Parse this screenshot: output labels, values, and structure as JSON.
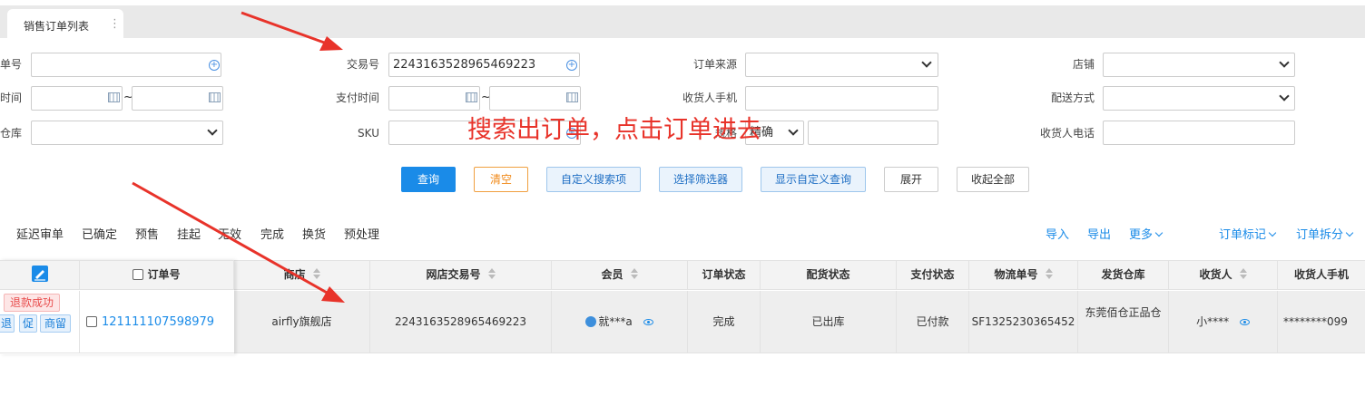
{
  "tab": {
    "title": "销售订单列表",
    "menu_glyph": "⋮"
  },
  "filters": {
    "row1": {
      "order_no_label": "单号",
      "trade_no_label": "交易号",
      "trade_no_value": "2243163528965469223",
      "source_label": "订单来源",
      "shop_label": "店铺"
    },
    "row2": {
      "time_label": "时间",
      "pay_time_label": "支付时间",
      "receiver_phone_label": "收货人手机",
      "delivery_label": "配送方式",
      "tilde": "~"
    },
    "row3": {
      "warehouse_label": "仓库",
      "sku_label": "SKU",
      "exact_label": "規格",
      "exact_value": "精确",
      "receiver_tel_label": "收货人电话"
    }
  },
  "annotation": {
    "text": "搜索出订单，点击订单进去",
    "color": "#e8332a"
  },
  "buttons": {
    "query": "查询",
    "clear": "清空",
    "custom_search": "自定义搜索项",
    "select_filter": "选择筛选器",
    "show_custom_query": "显示自定义查询",
    "expand": "展开",
    "collapse_all": "收起全部"
  },
  "status_tabs": [
    "延迟审单",
    "已确定",
    "预售",
    "挂起",
    "无效",
    "完成",
    "换货",
    "预处理"
  ],
  "toolbar_links": {
    "import": "导入",
    "export": "导出",
    "more": "更多",
    "order_mark": "订单标记",
    "order_split": "订单拆分"
  },
  "table": {
    "headers": {
      "order_no": "订单号",
      "shop": "商店",
      "online_trade_no": "网店交易号",
      "member": "会员",
      "order_status": "订单状态",
      "distribution_status": "配货状态",
      "pay_status": "支付状态",
      "logistics_no": "物流单号",
      "warehouse": "发货仓库",
      "receiver": "收货人",
      "receiver_mobile": "收货人手机"
    },
    "row": {
      "tag_refund": "退款成功",
      "tag_return": "退",
      "tag_promo": "促",
      "tag_merchant": "商留",
      "order_no": "121111107598979",
      "shop": "airfly旗舰店",
      "online_trade_no": "2243163528965469223",
      "member": "就***a",
      "order_status": "完成",
      "distribution_status": "已出库",
      "pay_status": "已付款",
      "logistics_no": "SF1325230365452",
      "warehouse": "东莞佰仓正品仓",
      "receiver": "小****",
      "receiver_mobile": "********099"
    }
  },
  "colors": {
    "primary": "#1a8be8",
    "annotation_red": "#e8332a",
    "header_bg": "#f3f3f3",
    "row_bg": "#eeeeee"
  }
}
